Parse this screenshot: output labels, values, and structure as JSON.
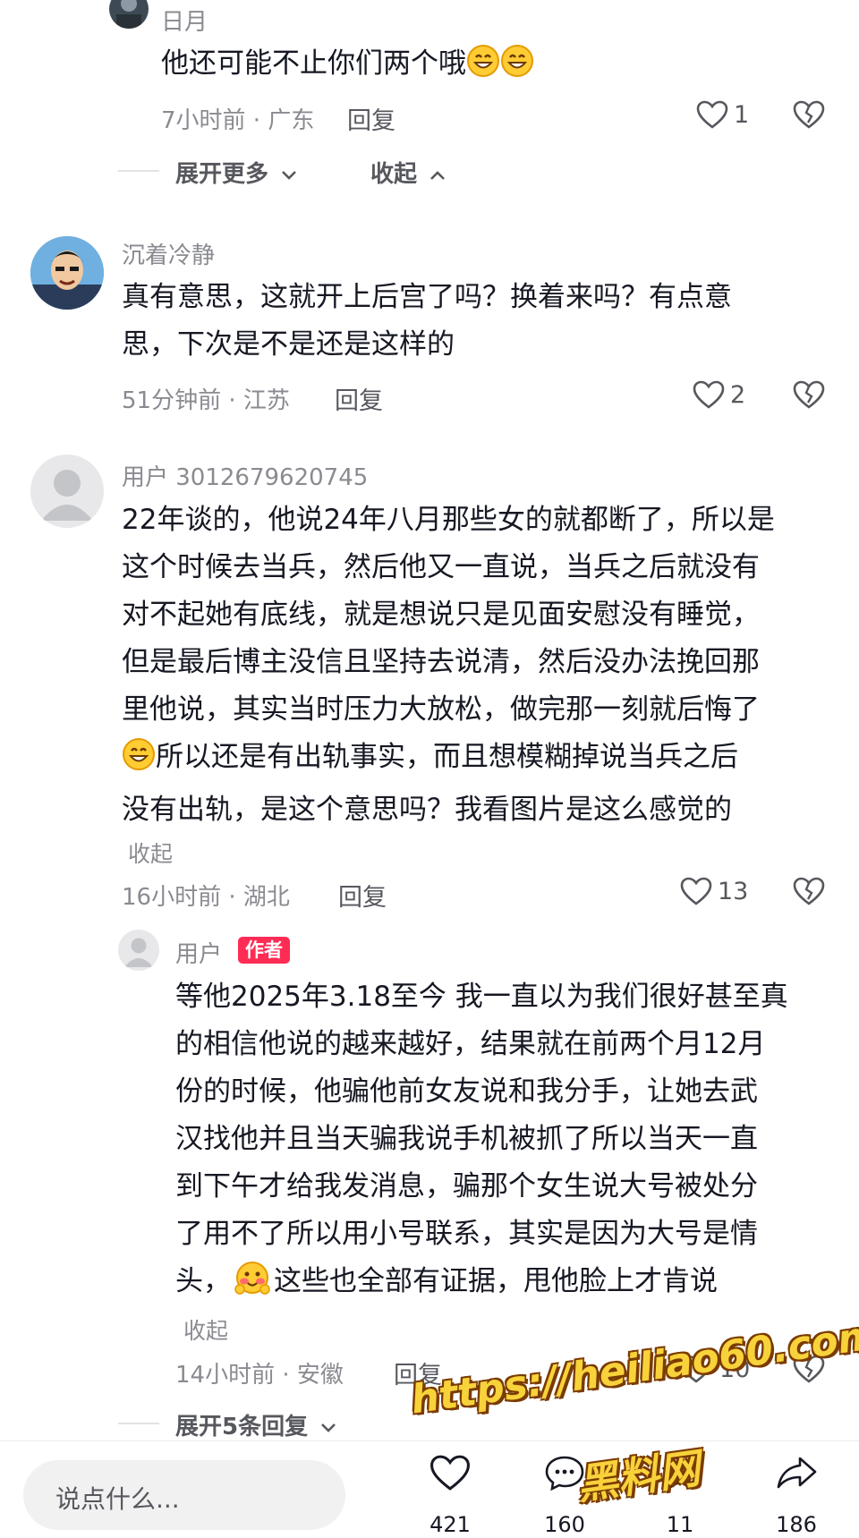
{
  "comments": [
    {
      "username": "日月",
      "text": "他还可能不止你们两个哦",
      "meta": "7小时前 · 广东",
      "reply_label": "回复",
      "likes": "1",
      "expand_more": "展开更多",
      "collapse": "收起"
    },
    {
      "username": "沉着冷静",
      "lines": [
        "真有意思，这就开上后宫了吗？换着来吗？有点意",
        "思，下次是不是还是这样的"
      ],
      "meta": "51分钟前 · 江苏",
      "reply_label": "回复",
      "likes": "2"
    },
    {
      "username": "用户 3012679620745",
      "lines": [
        "22年谈的，他说24年八月那些女的就都断了，所以是",
        "这个时候去当兵，然后他又一直说，当兵之后就没有",
        "对不起她有底线，就是想说只是见面安慰没有睡觉，",
        "但是最后博主没信且坚持去说清，然后没办法挽回那",
        "里他说，其实当时压力大放松，做完那一刻就后悔了",
        "所以还是有出轨事实，而且想模糊掉说当兵之后",
        "没有出轨，是这个意思吗？我看图片是这么感觉的"
      ],
      "fold": "收起",
      "meta": "16小时前 · 湖北",
      "reply_label": "回复",
      "likes": "13"
    },
    {
      "username": "用户",
      "badge": "作者",
      "lines": [
        "等他2025年3.18至今 我一直以为我们很好甚至真",
        "的相信他说的越来越好，结果就在前两个月12月",
        "份的时候，他骗他前女友说和我分手，让她去武",
        "汉找他并且当天骗我说手机被抓了所以当天一直",
        "到下午才给我发消息，骗那个女生说大号被处分",
        "了用不了所以用小号联系，其实是因为大号是情",
        "头，",
        "这些也全部有证据，甩他脸上才肯说"
      ],
      "fold": "收起",
      "meta": "14小时前 · 安徽",
      "reply_label": "回复",
      "likes": "10",
      "expand_replies": "展开5条回复"
    }
  ],
  "bottom_bar": {
    "input_placeholder": "说点什么...",
    "likes": "421",
    "comments": "160",
    "favorites": "11",
    "shares": "186"
  },
  "watermark": {
    "url": "https://heiliao60.com",
    "site": "黑料网"
  },
  "colors": {
    "accent": "#fe2c55",
    "muted": "#8a8b91"
  }
}
